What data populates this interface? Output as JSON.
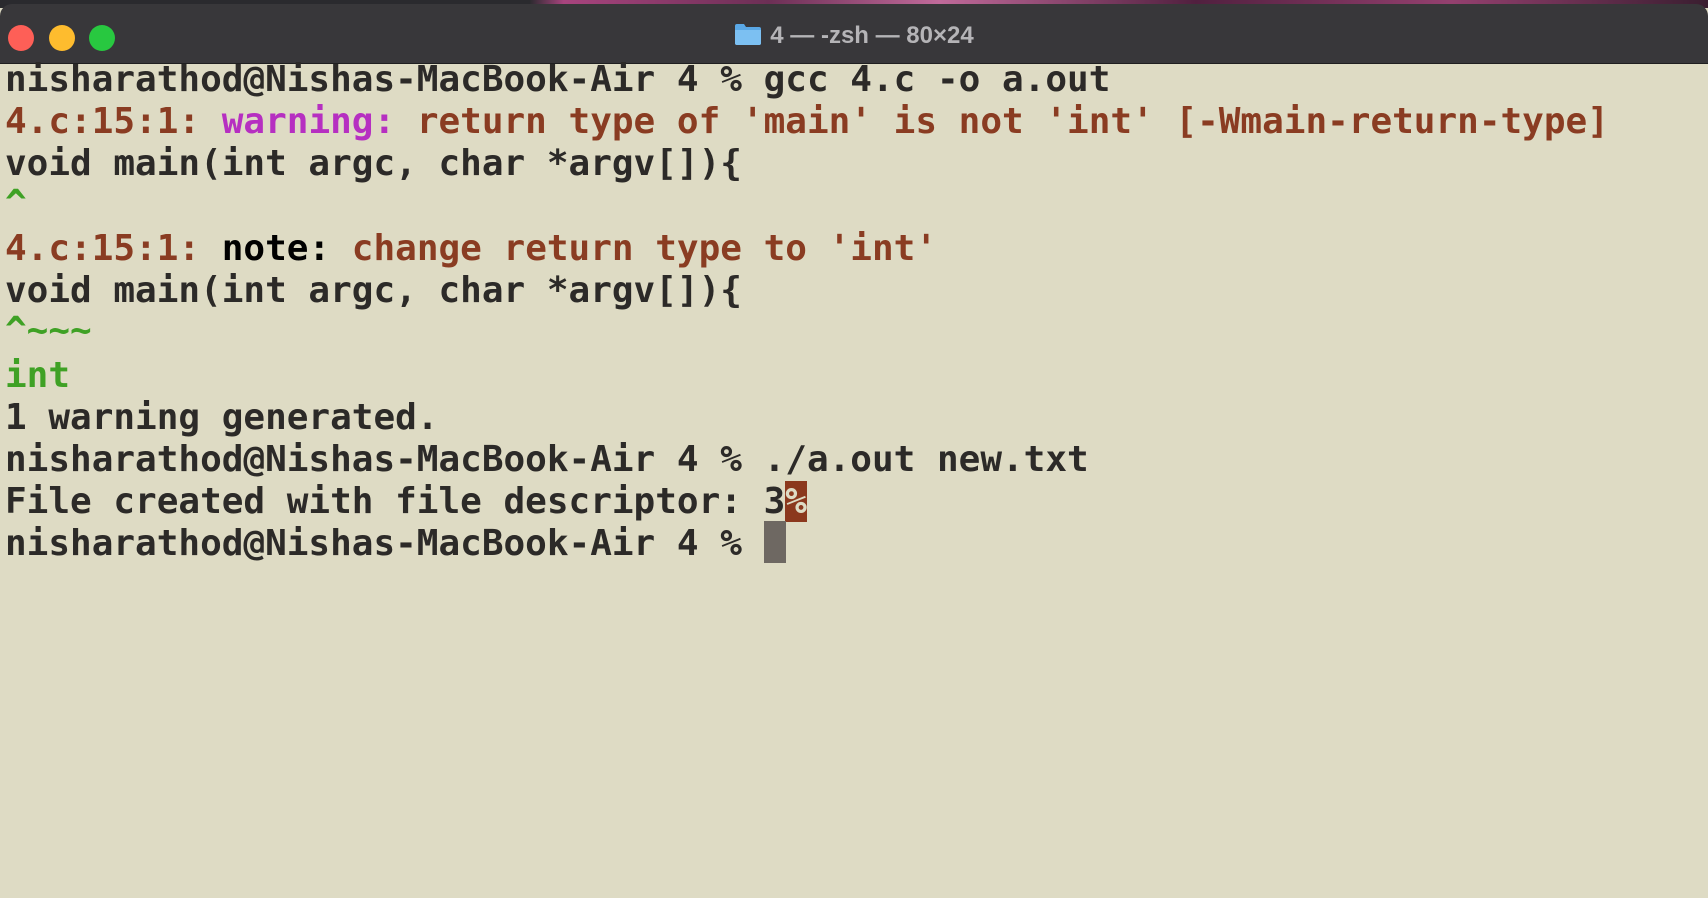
{
  "window": {
    "title": "4 — -zsh — 80×24",
    "folder_icon": "folder-icon",
    "controls": [
      "close",
      "minimize",
      "zoom"
    ]
  },
  "colors": {
    "background": "#dedbc4",
    "text": "#2c2a28",
    "error_location": "#8a3c22",
    "warning": "#b62fc1",
    "caret": "#3fa125",
    "titlebar": "#38373a"
  },
  "terminal": {
    "lines": [
      {
        "prompt": "nisharathod@Nishas-MacBook-Air 4 % ",
        "command": "gcc 4.c -o a.out"
      },
      {
        "location": "4.c:15:1: ",
        "kind": "warning:",
        "message": " return type of 'main' is not 'int' [-Wmain-return-type]"
      },
      {
        "text": "void main(int argc, char *argv[]){"
      },
      {
        "text": "^"
      },
      {
        "location": "4.c:15:1: ",
        "kind": "note:",
        "message": " change return type to 'int'"
      },
      {
        "text": "void main(int argc, char *argv[]){"
      },
      {
        "text": "^~~~"
      },
      {
        "text": "int"
      },
      {
        "text": "1 warning generated."
      },
      {
        "prompt": "nisharathod@Nishas-MacBook-Air 4 % ",
        "command": "./a.out new.txt"
      },
      {
        "text": "File created with file descriptor: 3",
        "no_newline_mark": "%"
      },
      {
        "prompt": "nisharathod@Nishas-MacBook-Air 4 % "
      }
    ]
  }
}
